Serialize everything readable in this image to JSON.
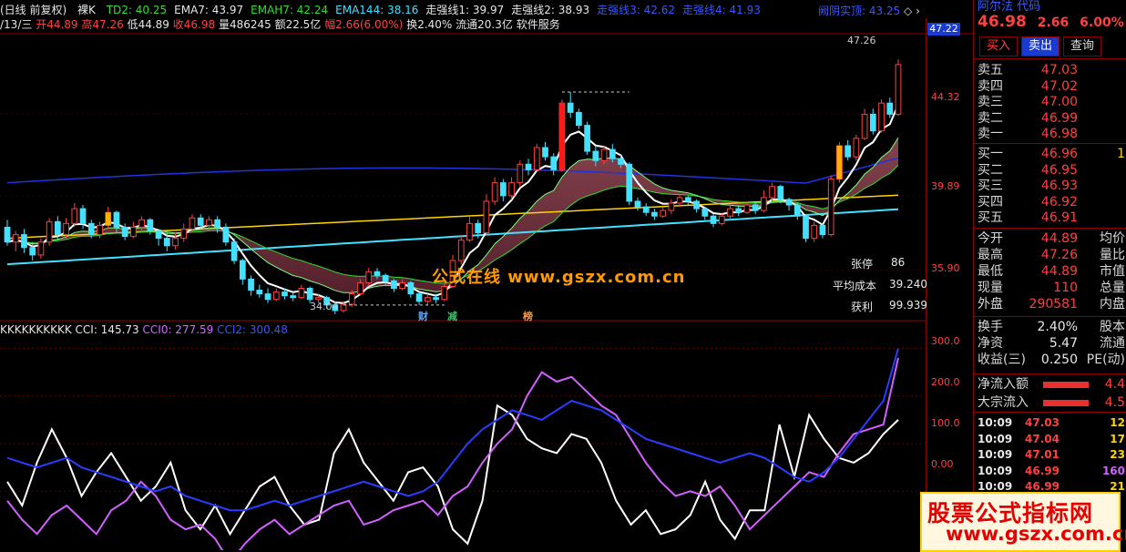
{
  "colors": {
    "up": "#ff4040",
    "down": "#44e0ff",
    "ma_white": "#ffffff",
    "ma_yellow": "#ffd400",
    "ma_green": "#33dd33",
    "ma_blue": "#2233dd",
    "ma_cyan": "#44e0ff",
    "cloud_pink": "#e06a80",
    "cloud_green": "#3fbf6a",
    "cci": "#ffffff",
    "cci0": "#d060ff",
    "cci2": "#2a3cff",
    "accent_red": "#8a0000"
  },
  "header": {
    "title": "(日线 前复权)",
    "mode": "裸K",
    "indicators": [
      {
        "label": "TD2: 40.25",
        "color": "green"
      },
      {
        "label": "EMA7: 43.97",
        "color": "white"
      },
      {
        "label": "EMAH7: 42.24",
        "color": "green"
      },
      {
        "label": "EMA144: 38.16",
        "color": "cyan"
      },
      {
        "label": "走强线1: 39.97",
        "color": "white"
      },
      {
        "label": "走强线2: 38.93",
        "color": "white"
      },
      {
        "label": "走强线3: 42.62",
        "color": "blue"
      },
      {
        "label": "走强线4: 41.93",
        "color": "blue"
      }
    ],
    "top_right": "阙阴实顶: 43.25"
  },
  "quote_line": {
    "date": "/13/三",
    "open": "开44.89",
    "high": "高47.26",
    "low": "低44.89",
    "close": "收46.98",
    "volume": "量486245",
    "amount": "额22.5亿",
    "change": "幅2.66(6.00%)",
    "turnover": "换2.40%",
    "float": "流通20.3亿",
    "sector": "软件服务"
  },
  "price_axis": {
    "current_tag": "47.22",
    "ticks": [
      "44.32",
      "39.89",
      "35.90"
    ]
  },
  "chart_data": [
    {
      "type": "candlestick",
      "title": "",
      "ylim": [
        33.5,
        48.5
      ],
      "annotations": {
        "high": "47.26",
        "low": "34.04",
        "zhangting_label": "张停",
        "zhangting_value": "86",
        "avg_cost_label": "平均成本",
        "avg_cost_value": "39.240",
        "profit_label": "获利",
        "profit_value": "99.939"
      },
      "markers": [
        "财",
        "减",
        "榜"
      ],
      "candles": [
        [
          38.2,
          37.4,
          38.6,
          37.2
        ],
        [
          37.4,
          37.8,
          38.0,
          36.9
        ],
        [
          37.8,
          37.1,
          38.1,
          36.8
        ],
        [
          37.1,
          36.7,
          37.4,
          36.4
        ],
        [
          36.7,
          37.4,
          37.6,
          36.5
        ],
        [
          37.4,
          38.5,
          38.7,
          37.2
        ],
        [
          38.5,
          37.8,
          38.8,
          37.5
        ],
        [
          37.8,
          38.4,
          38.7,
          37.6
        ],
        [
          38.4,
          39.2,
          39.5,
          38.2
        ],
        [
          39.2,
          38.4,
          39.4,
          38.1
        ],
        [
          38.4,
          37.8,
          38.6,
          37.6
        ],
        [
          37.8,
          38.3,
          38.5,
          37.6
        ],
        [
          38.3,
          39.0,
          39.3,
          38.1
        ],
        [
          39.0,
          38.2,
          39.1,
          37.9
        ],
        [
          38.2,
          37.7,
          38.4,
          37.5
        ],
        [
          37.7,
          38.2,
          38.5,
          37.6
        ],
        [
          38.2,
          38.6,
          38.8,
          37.9
        ],
        [
          38.6,
          38.0,
          38.7,
          37.8
        ],
        [
          38.0,
          37.6,
          38.1,
          37.2
        ],
        [
          37.6,
          37.2,
          37.9,
          36.9
        ],
        [
          37.2,
          37.6,
          37.9,
          37.0
        ],
        [
          37.6,
          38.1,
          38.4,
          37.4
        ],
        [
          38.1,
          38.7,
          38.9,
          37.9
        ],
        [
          38.7,
          38.3,
          38.9,
          38.1
        ],
        [
          38.3,
          38.6,
          38.8,
          38.0
        ],
        [
          38.6,
          38.2,
          38.8,
          37.9
        ],
        [
          38.2,
          37.4,
          38.4,
          37.2
        ],
        [
          37.4,
          36.4,
          37.6,
          36.2
        ],
        [
          36.4,
          35.4,
          36.5,
          35.1
        ],
        [
          35.4,
          34.8,
          35.6,
          34.5
        ],
        [
          34.8,
          34.6,
          35.1,
          34.4
        ],
        [
          34.6,
          34.3,
          34.9,
          34.1
        ],
        [
          34.3,
          34.7,
          34.9,
          34.2
        ],
        [
          34.7,
          34.5,
          34.9,
          34.3
        ],
        [
          34.5,
          34.4,
          34.7,
          34.2
        ],
        [
          34.4,
          34.9,
          35.1,
          34.3
        ],
        [
          34.9,
          34.3,
          35.0,
          34.1
        ],
        [
          34.3,
          34.4,
          34.6,
          34.1
        ],
        [
          34.4,
          34.0,
          34.5,
          33.8
        ],
        [
          34.0,
          33.7,
          34.2,
          33.5
        ],
        [
          33.7,
          34.04,
          34.2,
          33.6
        ],
        [
          34.04,
          34.6,
          34.8,
          33.9
        ],
        [
          34.6,
          35.2,
          35.4,
          34.5
        ],
        [
          35.2,
          35.8,
          36.0,
          35.0
        ],
        [
          35.8,
          35.6,
          36.0,
          35.4
        ],
        [
          35.6,
          35.3,
          35.7,
          35.1
        ],
        [
          35.3,
          34.9,
          35.4,
          34.7
        ],
        [
          34.9,
          35.2,
          35.4,
          34.8
        ],
        [
          35.2,
          34.6,
          35.3,
          34.4
        ],
        [
          34.6,
          34.2,
          34.7,
          34.0
        ],
        [
          34.2,
          34.4,
          34.6,
          34.0
        ],
        [
          34.4,
          34.3,
          34.6,
          34.1
        ],
        [
          34.3,
          35.0,
          35.2,
          34.2
        ],
        [
          35.0,
          36.4,
          36.7,
          34.9
        ],
        [
          36.4,
          37.5,
          37.8,
          36.2
        ],
        [
          37.5,
          38.4,
          38.8,
          37.4
        ],
        [
          38.4,
          37.9,
          38.6,
          37.6
        ],
        [
          37.9,
          39.6,
          40.0,
          37.8
        ],
        [
          39.6,
          40.6,
          40.9,
          39.4
        ],
        [
          40.6,
          39.9,
          40.8,
          39.6
        ],
        [
          39.9,
          40.6,
          40.9,
          39.7
        ],
        [
          40.6,
          41.6,
          41.8,
          40.4
        ],
        [
          41.6,
          41.3,
          41.9,
          41.0
        ],
        [
          41.3,
          42.5,
          42.7,
          41.2
        ],
        [
          42.5,
          42.0,
          42.8,
          41.8
        ],
        [
          42.0,
          41.3,
          42.2,
          41.0
        ],
        [
          41.3,
          44.9,
          45.1,
          41.2
        ],
        [
          44.9,
          44.4,
          45.5,
          44.1
        ],
        [
          44.4,
          43.7,
          44.6,
          43.5
        ],
        [
          43.7,
          42.3,
          43.9,
          42.1
        ],
        [
          42.3,
          41.8,
          42.6,
          41.5
        ],
        [
          41.8,
          42.4,
          42.6,
          41.6
        ],
        [
          42.4,
          41.9,
          42.7,
          41.7
        ],
        [
          41.9,
          41.6,
          42.1,
          41.4
        ],
        [
          41.6,
          39.6,
          41.7,
          39.4
        ],
        [
          39.6,
          39.3,
          39.8,
          39.1
        ],
        [
          39.3,
          39.0,
          39.5,
          38.8
        ],
        [
          39.0,
          38.8,
          39.2,
          38.6
        ],
        [
          38.8,
          39.1,
          39.3,
          38.7
        ],
        [
          39.1,
          39.5,
          39.7,
          38.9
        ],
        [
          39.5,
          39.8,
          40.0,
          39.3
        ],
        [
          39.8,
          39.6,
          39.9,
          39.4
        ],
        [
          39.6,
          39.2,
          39.7,
          39.0
        ],
        [
          39.2,
          38.8,
          39.3,
          38.6
        ],
        [
          38.8,
          38.4,
          38.9,
          38.2
        ],
        [
          38.4,
          38.8,
          39.0,
          38.3
        ],
        [
          38.8,
          39.2,
          39.4,
          38.6
        ],
        [
          39.2,
          39.0,
          39.4,
          38.8
        ],
        [
          39.0,
          39.4,
          39.6,
          38.9
        ],
        [
          39.4,
          39.1,
          39.5,
          38.9
        ],
        [
          39.1,
          39.8,
          40.2,
          39.0
        ],
        [
          39.8,
          40.4,
          40.6,
          39.6
        ],
        [
          40.4,
          39.7,
          40.5,
          39.5
        ],
        [
          39.7,
          39.4,
          39.8,
          39.1
        ],
        [
          39.4,
          38.8,
          39.5,
          38.6
        ],
        [
          38.8,
          37.6,
          38.9,
          37.4
        ],
        [
          37.6,
          38.3,
          38.5,
          37.4
        ],
        [
          38.3,
          37.8,
          38.4,
          37.6
        ],
        [
          37.8,
          40.8,
          41.0,
          37.7
        ],
        [
          40.8,
          42.6,
          42.8,
          40.6
        ],
        [
          42.6,
          42.0,
          42.9,
          41.8
        ],
        [
          42.0,
          43.0,
          43.2,
          41.8
        ],
        [
          43.0,
          44.3,
          44.6,
          42.9
        ],
        [
          44.3,
          43.4,
          44.6,
          43.2
        ],
        [
          43.4,
          44.9,
          45.1,
          43.3
        ],
        [
          44.9,
          44.3,
          45.2,
          44.1
        ],
        [
          44.3,
          46.98,
          47.26,
          44.2
        ]
      ]
    },
    {
      "type": "line",
      "title": "CCI",
      "ylim": [
        -120,
        320
      ],
      "yticks": [
        "300.0",
        "200.0",
        "100.0",
        "0.00"
      ],
      "legend": [
        "KKKKKKKKKK",
        "CCI: 145.73",
        "CCI0: 277.59",
        "CCI2: 300.48"
      ],
      "series": [
        {
          "name": "CCI",
          "values": [
            20,
            -30,
            60,
            130,
            70,
            -10,
            40,
            80,
            30,
            -20,
            10,
            60,
            -40,
            -80,
            -30,
            -90,
            -40,
            10,
            30,
            -30,
            -70,
            -60,
            80,
            130,
            60,
            20,
            -20,
            40,
            50,
            10,
            -80,
            -110,
            -20,
            180,
            160,
            110,
            90,
            80,
            120,
            110,
            60,
            -20,
            -70,
            -40,
            -90,
            -80,
            -50,
            20,
            -60,
            -100,
            -40,
            -40,
            140,
            30,
            160,
            110,
            70,
            60,
            80,
            120,
            150
          ]
        },
        {
          "name": "CCI0",
          "values": [
            -20,
            -60,
            -90,
            -50,
            -30,
            -60,
            -90,
            -40,
            -20,
            20,
            -10,
            -60,
            -80,
            -70,
            -100,
            -150,
            -110,
            -80,
            -60,
            -90,
            -70,
            -50,
            -30,
            -20,
            -70,
            -60,
            -40,
            -30,
            -20,
            -50,
            -10,
            10,
            60,
            100,
            130,
            200,
            250,
            230,
            240,
            210,
            180,
            160,
            110,
            60,
            20,
            -10,
            0,
            -10,
            10,
            -30,
            -80,
            -50,
            -20,
            10,
            40,
            30,
            80,
            120,
            130,
            140,
            280
          ]
        },
        {
          "name": "CCI2",
          "values": [
            70,
            60,
            50,
            60,
            70,
            50,
            40,
            30,
            20,
            10,
            0,
            10,
            -10,
            -20,
            -30,
            -40,
            -40,
            -30,
            -20,
            -30,
            -20,
            -10,
            0,
            10,
            20,
            10,
            0,
            -10,
            0,
            20,
            60,
            100,
            130,
            150,
            170,
            160,
            150,
            170,
            190,
            180,
            170,
            150,
            130,
            110,
            100,
            90,
            80,
            70,
            60,
            70,
            80,
            70,
            50,
            30,
            20,
            40,
            70,
            110,
            150,
            190,
            300
          ]
        }
      ]
    }
  ],
  "chart_labels": {
    "price_watermark": "公式在线 www.gszx.com.cn"
  },
  "right_panel": {
    "stock_name": "阿尔法 代码",
    "price": "46.98",
    "change": "2.66",
    "pct": "6.00%",
    "buttons": [
      "买入",
      "卖出",
      "查询"
    ],
    "asks": [
      {
        "label": "卖五",
        "price": "47.03"
      },
      {
        "label": "卖四",
        "price": "47.02"
      },
      {
        "label": "卖三",
        "price": "47.00"
      },
      {
        "label": "卖二",
        "price": "46.99"
      },
      {
        "label": "卖一",
        "price": "46.98"
      }
    ],
    "bids": [
      {
        "label": "买一",
        "price": "46.96",
        "vol": "1"
      },
      {
        "label": "买二",
        "price": "46.95"
      },
      {
        "label": "买三",
        "price": "46.93"
      },
      {
        "label": "买四",
        "price": "46.92"
      },
      {
        "label": "买五",
        "price": "46.91"
      }
    ],
    "stats": [
      {
        "label": "今开",
        "value": "44.89",
        "extra": "均价"
      },
      {
        "label": "最高",
        "value": "47.26",
        "extra": "量比"
      },
      {
        "label": "最低",
        "value": "44.89",
        "extra": "市值"
      },
      {
        "label": "现量",
        "value": "110",
        "extra": "总量"
      },
      {
        "label": "外盘",
        "value": "290581",
        "extra": "内盘"
      }
    ],
    "stats2": [
      {
        "label": "换手",
        "value": "2.40%",
        "extra": "股本"
      },
      {
        "label": "净资",
        "value": "5.47",
        "extra": "流通"
      },
      {
        "label": "收益(三)",
        "value": "0.250",
        "extra": "PE(动)"
      }
    ],
    "flows": [
      {
        "label": "净流入额",
        "value": "4.4"
      },
      {
        "label": "大宗流入",
        "value": "4.5"
      }
    ],
    "ticks": [
      {
        "time": "10:09",
        "price": "47.03",
        "vol": "12"
      },
      {
        "time": "10:09",
        "price": "47.04",
        "vol": "17"
      },
      {
        "time": "10:09",
        "price": "47.01",
        "vol": "23"
      },
      {
        "time": "10:09",
        "price": "46.99",
        "vol": "160"
      },
      {
        "time": "10:09",
        "price": "46.99",
        "vol": "21"
      }
    ]
  },
  "banner": {
    "line1": "股票公式指标网",
    "line2": "www.gszx.com.cn"
  }
}
